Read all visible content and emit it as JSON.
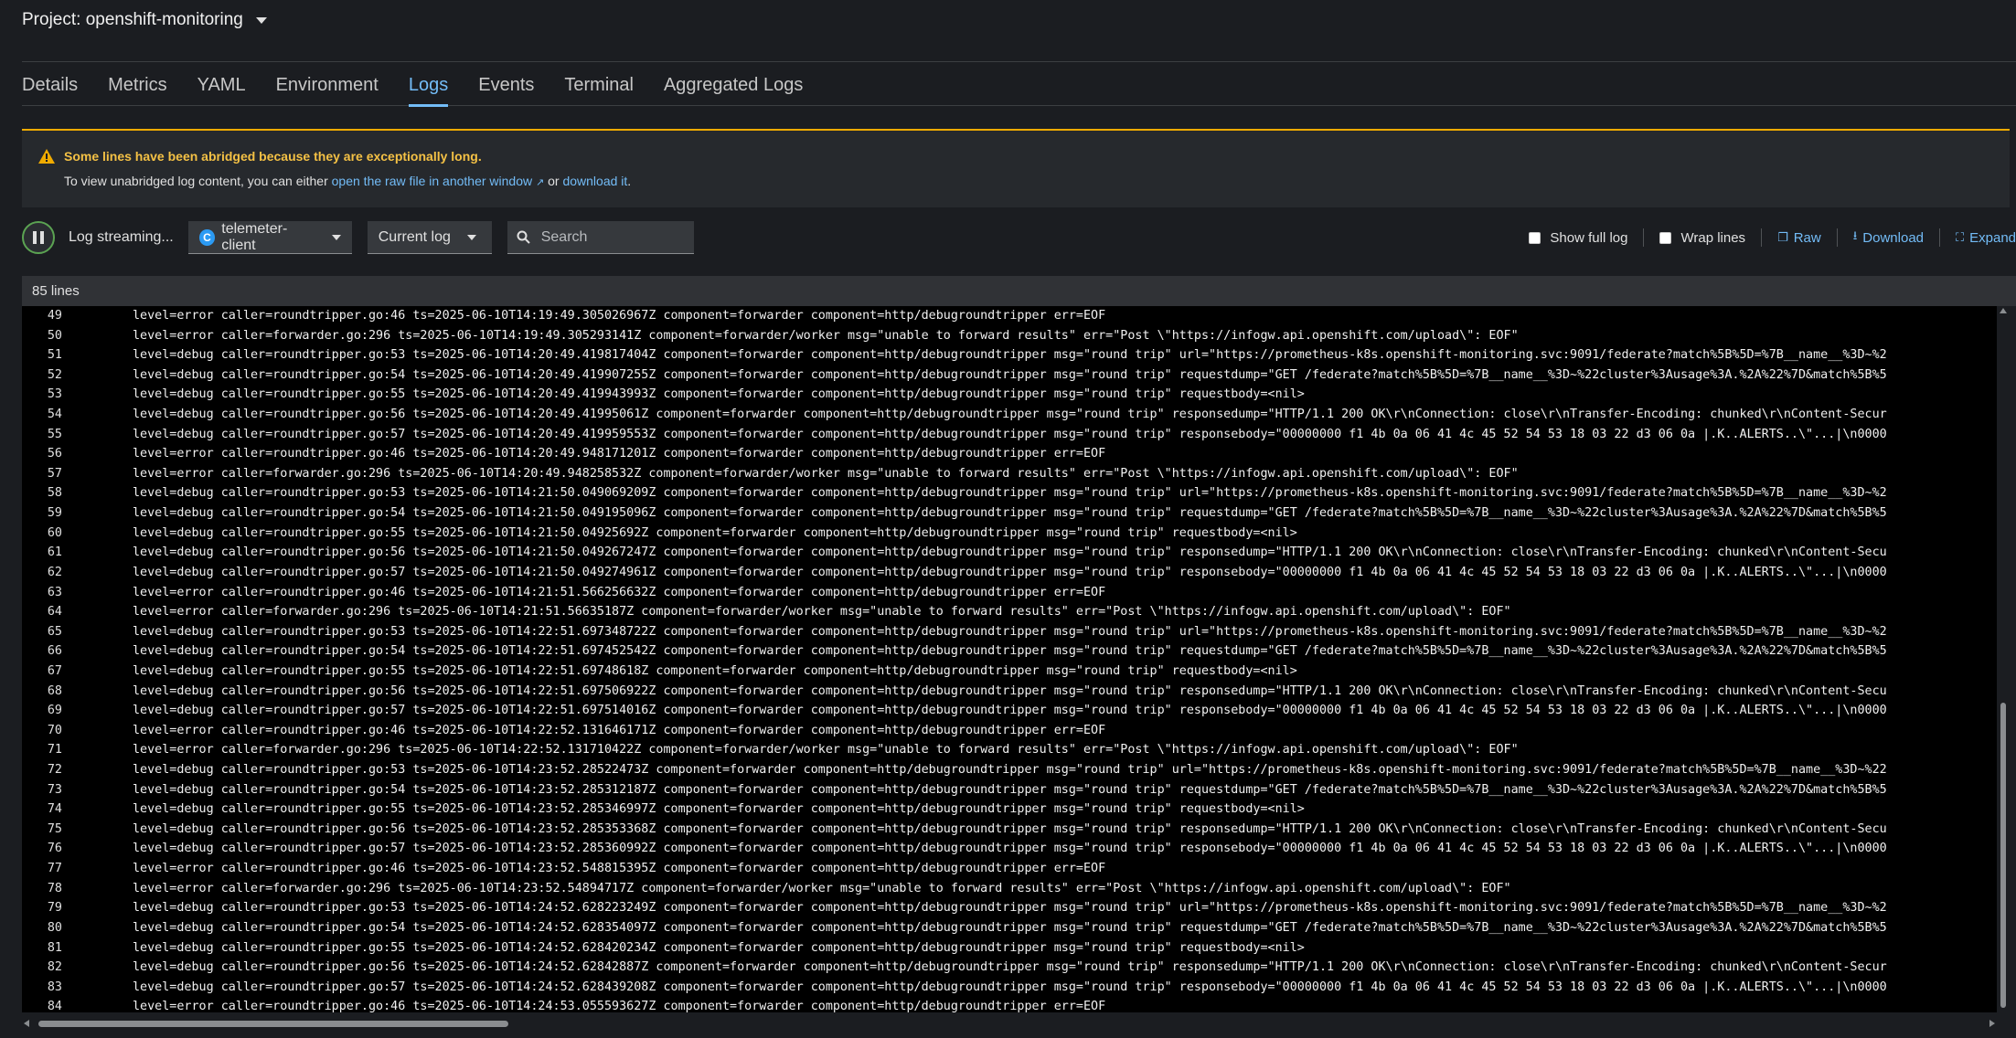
{
  "project": {
    "label": "Project: openshift-monitoring"
  },
  "tabs": [
    {
      "label": "Details"
    },
    {
      "label": "Metrics"
    },
    {
      "label": "YAML"
    },
    {
      "label": "Environment"
    },
    {
      "label": "Logs",
      "active": true
    },
    {
      "label": "Events"
    },
    {
      "label": "Terminal"
    },
    {
      "label": "Aggregated Logs"
    }
  ],
  "alert": {
    "title": "Some lines have been abridged because they are exceptionally long.",
    "body_prefix": "To view unabridged log content, you can either",
    "link_raw": "open the raw file in another window",
    "body_mid": "or",
    "link_download": "download it",
    "body_suffix": "."
  },
  "toolbar": {
    "streaming_label": "Log streaming...",
    "container_badge": "C",
    "container_value": "telemeter-client",
    "log_select_value": "Current log",
    "search_placeholder": "Search",
    "show_full_log_label": "Show full log",
    "wrap_lines_label": "Wrap lines",
    "raw_label": "Raw",
    "download_label": "Download",
    "expand_label": "Expand"
  },
  "log": {
    "line_count": "85 lines",
    "lines": [
      {
        "n": "49",
        "t": "level=error caller=roundtripper.go:46 ts=2025-06-10T14:19:49.305026967Z component=forwarder component=http/debugroundtripper err=EOF"
      },
      {
        "n": "50",
        "t": "level=error caller=forwarder.go:296 ts=2025-06-10T14:19:49.305293141Z component=forwarder/worker msg=\"unable to forward results\" err=\"Post \\\"https://infogw.api.openshift.com/upload\\\": EOF\""
      },
      {
        "n": "51",
        "t": "level=debug caller=roundtripper.go:53 ts=2025-06-10T14:20:49.419817404Z component=forwarder component=http/debugroundtripper msg=\"round trip\" url=\"https://prometheus-k8s.openshift-monitoring.svc:9091/federate?match%5B%5D=%7B__name__%3D~%2"
      },
      {
        "n": "52",
        "t": "level=debug caller=roundtripper.go:54 ts=2025-06-10T14:20:49.419907255Z component=forwarder component=http/debugroundtripper msg=\"round trip\" requestdump=\"GET /federate?match%5B%5D=%7B__name__%3D~%22cluster%3Ausage%3A.%2A%22%7D&match%5B%5"
      },
      {
        "n": "53",
        "t": "level=debug caller=roundtripper.go:55 ts=2025-06-10T14:20:49.419943993Z component=forwarder component=http/debugroundtripper msg=\"round trip\" requestbody=<nil>"
      },
      {
        "n": "54",
        "t": "level=debug caller=roundtripper.go:56 ts=2025-06-10T14:20:49.41995061Z component=forwarder component=http/debugroundtripper msg=\"round trip\" responsedump=\"HTTP/1.1 200 OK\\r\\nConnection: close\\r\\nTransfer-Encoding: chunked\\r\\nContent-Secur"
      },
      {
        "n": "55",
        "t": "level=debug caller=roundtripper.go:57 ts=2025-06-10T14:20:49.419959553Z component=forwarder component=http/debugroundtripper msg=\"round trip\" responsebody=\"00000000 f1 4b 0a 06 41 4c 45 52 54 53 18 03 22 d3 06 0a |.K..ALERTS..\\\"...|\\n0000"
      },
      {
        "n": "56",
        "t": "level=error caller=roundtripper.go:46 ts=2025-06-10T14:20:49.948171201Z component=forwarder component=http/debugroundtripper err=EOF"
      },
      {
        "n": "57",
        "t": "level=error caller=forwarder.go:296 ts=2025-06-10T14:20:49.948258532Z component=forwarder/worker msg=\"unable to forward results\" err=\"Post \\\"https://infogw.api.openshift.com/upload\\\": EOF\""
      },
      {
        "n": "58",
        "t": "level=debug caller=roundtripper.go:53 ts=2025-06-10T14:21:50.049069209Z component=forwarder component=http/debugroundtripper msg=\"round trip\" url=\"https://prometheus-k8s.openshift-monitoring.svc:9091/federate?match%5B%5D=%7B__name__%3D~%2"
      },
      {
        "n": "59",
        "t": "level=debug caller=roundtripper.go:54 ts=2025-06-10T14:21:50.049195096Z component=forwarder component=http/debugroundtripper msg=\"round trip\" requestdump=\"GET /federate?match%5B%5D=%7B__name__%3D~%22cluster%3Ausage%3A.%2A%22%7D&match%5B%5"
      },
      {
        "n": "60",
        "t": "level=debug caller=roundtripper.go:55 ts=2025-06-10T14:21:50.04925692Z component=forwarder component=http/debugroundtripper msg=\"round trip\" requestbody=<nil>"
      },
      {
        "n": "61",
        "t": "level=debug caller=roundtripper.go:56 ts=2025-06-10T14:21:50.049267247Z component=forwarder component=http/debugroundtripper msg=\"round trip\" responsedump=\"HTTP/1.1 200 OK\\r\\nConnection: close\\r\\nTransfer-Encoding: chunked\\r\\nContent-Secu"
      },
      {
        "n": "62",
        "t": "level=debug caller=roundtripper.go:57 ts=2025-06-10T14:21:50.049274961Z component=forwarder component=http/debugroundtripper msg=\"round trip\" responsebody=\"00000000 f1 4b 0a 06 41 4c 45 52 54 53 18 03 22 d3 06 0a |.K..ALERTS..\\\"...|\\n0000"
      },
      {
        "n": "63",
        "t": "level=error caller=roundtripper.go:46 ts=2025-06-10T14:21:51.566256632Z component=forwarder component=http/debugroundtripper err=EOF"
      },
      {
        "n": "64",
        "t": "level=error caller=forwarder.go:296 ts=2025-06-10T14:21:51.56635187Z component=forwarder/worker msg=\"unable to forward results\" err=\"Post \\\"https://infogw.api.openshift.com/upload\\\": EOF\""
      },
      {
        "n": "65",
        "t": "level=debug caller=roundtripper.go:53 ts=2025-06-10T14:22:51.697348722Z component=forwarder component=http/debugroundtripper msg=\"round trip\" url=\"https://prometheus-k8s.openshift-monitoring.svc:9091/federate?match%5B%5D=%7B__name__%3D~%2"
      },
      {
        "n": "66",
        "t": "level=debug caller=roundtripper.go:54 ts=2025-06-10T14:22:51.697452542Z component=forwarder component=http/debugroundtripper msg=\"round trip\" requestdump=\"GET /federate?match%5B%5D=%7B__name__%3D~%22cluster%3Ausage%3A.%2A%22%7D&match%5B%5"
      },
      {
        "n": "67",
        "t": "level=debug caller=roundtripper.go:55 ts=2025-06-10T14:22:51.69748618Z component=forwarder component=http/debugroundtripper msg=\"round trip\" requestbody=<nil>"
      },
      {
        "n": "68",
        "t": "level=debug caller=roundtripper.go:56 ts=2025-06-10T14:22:51.697506922Z component=forwarder component=http/debugroundtripper msg=\"round trip\" responsedump=\"HTTP/1.1 200 OK\\r\\nConnection: close\\r\\nTransfer-Encoding: chunked\\r\\nContent-Secu"
      },
      {
        "n": "69",
        "t": "level=debug caller=roundtripper.go:57 ts=2025-06-10T14:22:51.697514016Z component=forwarder component=http/debugroundtripper msg=\"round trip\" responsebody=\"00000000 f1 4b 0a 06 41 4c 45 52 54 53 18 03 22 d3 06 0a |.K..ALERTS..\\\"...|\\n0000"
      },
      {
        "n": "70",
        "t": "level=error caller=roundtripper.go:46 ts=2025-06-10T14:22:52.131646171Z component=forwarder component=http/debugroundtripper err=EOF"
      },
      {
        "n": "71",
        "t": "level=error caller=forwarder.go:296 ts=2025-06-10T14:22:52.131710422Z component=forwarder/worker msg=\"unable to forward results\" err=\"Post \\\"https://infogw.api.openshift.com/upload\\\": EOF\""
      },
      {
        "n": "72",
        "t": "level=debug caller=roundtripper.go:53 ts=2025-06-10T14:23:52.28522473Z component=forwarder component=http/debugroundtripper msg=\"round trip\" url=\"https://prometheus-k8s.openshift-monitoring.svc:9091/federate?match%5B%5D=%7B__name__%3D~%22"
      },
      {
        "n": "73",
        "t": "level=debug caller=roundtripper.go:54 ts=2025-06-10T14:23:52.285312187Z component=forwarder component=http/debugroundtripper msg=\"round trip\" requestdump=\"GET /federate?match%5B%5D=%7B__name__%3D~%22cluster%3Ausage%3A.%2A%22%7D&match%5B%5"
      },
      {
        "n": "74",
        "t": "level=debug caller=roundtripper.go:55 ts=2025-06-10T14:23:52.285346997Z component=forwarder component=http/debugroundtripper msg=\"round trip\" requestbody=<nil>"
      },
      {
        "n": "75",
        "t": "level=debug caller=roundtripper.go:56 ts=2025-06-10T14:23:52.285353368Z component=forwarder component=http/debugroundtripper msg=\"round trip\" responsedump=\"HTTP/1.1 200 OK\\r\\nConnection: close\\r\\nTransfer-Encoding: chunked\\r\\nContent-Secu"
      },
      {
        "n": "76",
        "t": "level=debug caller=roundtripper.go:57 ts=2025-06-10T14:23:52.285360992Z component=forwarder component=http/debugroundtripper msg=\"round trip\" responsebody=\"00000000 f1 4b 0a 06 41 4c 45 52 54 53 18 03 22 d3 06 0a |.K..ALERTS..\\\"...|\\n0000"
      },
      {
        "n": "77",
        "t": "level=error caller=roundtripper.go:46 ts=2025-06-10T14:23:52.548815395Z component=forwarder component=http/debugroundtripper err=EOF"
      },
      {
        "n": "78",
        "t": "level=error caller=forwarder.go:296 ts=2025-06-10T14:23:52.54894717Z component=forwarder/worker msg=\"unable to forward results\" err=\"Post \\\"https://infogw.api.openshift.com/upload\\\": EOF\""
      },
      {
        "n": "79",
        "t": "level=debug caller=roundtripper.go:53 ts=2025-06-10T14:24:52.628223249Z component=forwarder component=http/debugroundtripper msg=\"round trip\" url=\"https://prometheus-k8s.openshift-monitoring.svc:9091/federate?match%5B%5D=%7B__name__%3D~%2"
      },
      {
        "n": "80",
        "t": "level=debug caller=roundtripper.go:54 ts=2025-06-10T14:24:52.628354097Z component=forwarder component=http/debugroundtripper msg=\"round trip\" requestdump=\"GET /federate?match%5B%5D=%7B__name__%3D~%22cluster%3Ausage%3A.%2A%22%7D&match%5B%5"
      },
      {
        "n": "81",
        "t": "level=debug caller=roundtripper.go:55 ts=2025-06-10T14:24:52.628420234Z component=forwarder component=http/debugroundtripper msg=\"round trip\" requestbody=<nil>"
      },
      {
        "n": "82",
        "t": "level=debug caller=roundtripper.go:56 ts=2025-06-10T14:24:52.62842887Z component=forwarder component=http/debugroundtripper msg=\"round trip\" responsedump=\"HTTP/1.1 200 OK\\r\\nConnection: close\\r\\nTransfer-Encoding: chunked\\r\\nContent-Secur"
      },
      {
        "n": "83",
        "t": "level=debug caller=roundtripper.go:57 ts=2025-06-10T14:24:52.628439208Z component=forwarder component=http/debugroundtripper msg=\"round trip\" responsebody=\"00000000 f1 4b 0a 06 41 4c 45 52 54 53 18 03 22 d3 06 0a |.K..ALERTS..\\\"...|\\n0000"
      },
      {
        "n": "84",
        "t": "level=error caller=roundtripper.go:46 ts=2025-06-10T14:24:53.055593627Z component=forwarder component=http/debugroundtripper err=EOF"
      }
    ]
  },
  "colors": {
    "accent": "#73bcf7",
    "warning": "#f0ab00",
    "streaming_ring": "#5ba352"
  },
  "icons": {
    "project_caret": "chevron-down-icon",
    "alert": "warning-triangle-icon",
    "pause": "pause-icon",
    "search": "search-icon",
    "raw": "window-icon",
    "download": "download-icon",
    "expand": "expand-icon"
  }
}
